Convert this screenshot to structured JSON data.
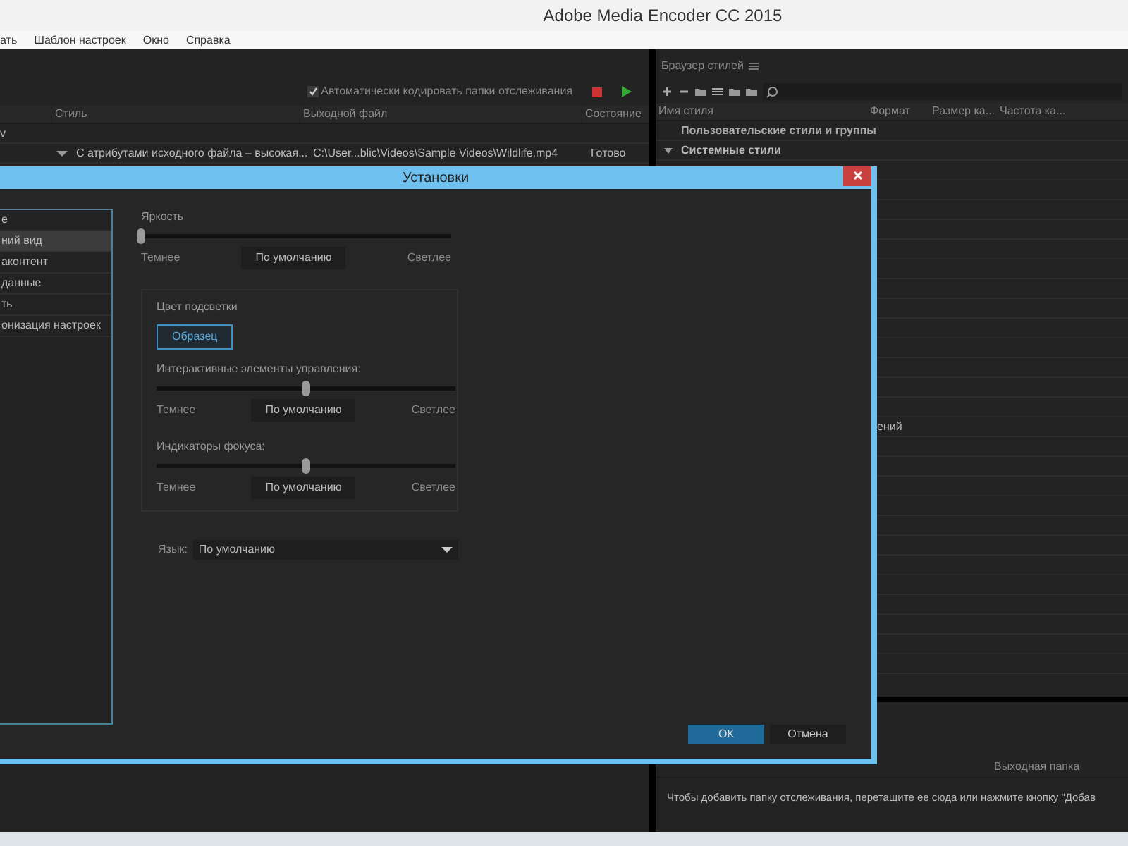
{
  "window": {
    "title": "Adobe Media Encoder CC 2015"
  },
  "menu": [
    "ать",
    "Шаблон настроек",
    "Окно",
    "Справка"
  ],
  "queue": {
    "auto_encode": {
      "label": "Автоматически кодировать папки отслеживания",
      "checked": true
    },
    "columns": [
      "Стиль",
      "Выходной файл",
      "Состояние"
    ],
    "source": "v",
    "rows": [
      {
        "style": "С атрибутами исходного файла – высокая...",
        "output": "C:\\User...blic\\Videos\\Sample Videos\\Wildlife.mp4",
        "status": "Готово"
      }
    ]
  },
  "preset_browser": {
    "title": "Браузер стилей",
    "columns": [
      "Имя стиля",
      "Формат",
      "Размер ка...",
      "Частота ка..."
    ],
    "user_presets": "Пользовательские стили и группы",
    "system_presets": {
      "label": "Системные стили",
      "expanded": true
    },
    "partial_row": "ений"
  },
  "watch_folders": {
    "columns": [
      "Выходная папка"
    ],
    "hint": "Чтобы добавить папку отслеживания, перетащите ее сюда или нажмите кнопку \"Добав"
  },
  "dialog": {
    "title": "Установки",
    "sidebar": [
      {
        "label": "е",
        "selected": false
      },
      {
        "label": "ний вид",
        "selected": true
      },
      {
        "label": "аконтент",
        "selected": false
      },
      {
        "label": "данные",
        "selected": false
      },
      {
        "label": "ть",
        "selected": false
      },
      {
        "label": "онизация настроек",
        "selected": false
      }
    ],
    "brightness": {
      "label": "Яркость",
      "level": 0,
      "darker": "Темнее",
      "default": "По умолчанию",
      "lighter": "Светлее"
    },
    "highlight": {
      "title": "Цвет подсветки",
      "sample": "Образец",
      "sliders": [
        {
          "label": "Интерактивные элементы управления:",
          "level": 0.5,
          "darker": "Темнее",
          "default": "По умолчанию",
          "lighter": "Светлее"
        },
        {
          "label": "Индикаторы фокуса:",
          "level": 0.5,
          "darker": "Темнее",
          "default": "По умолчанию",
          "lighter": "Светлее"
        }
      ]
    },
    "language": {
      "label": "Язык:",
      "value": "По умолчанию"
    },
    "buttons": [
      {
        "label": "ОК",
        "primary": true
      },
      {
        "label": "Отмена",
        "primary": false
      }
    ]
  }
}
